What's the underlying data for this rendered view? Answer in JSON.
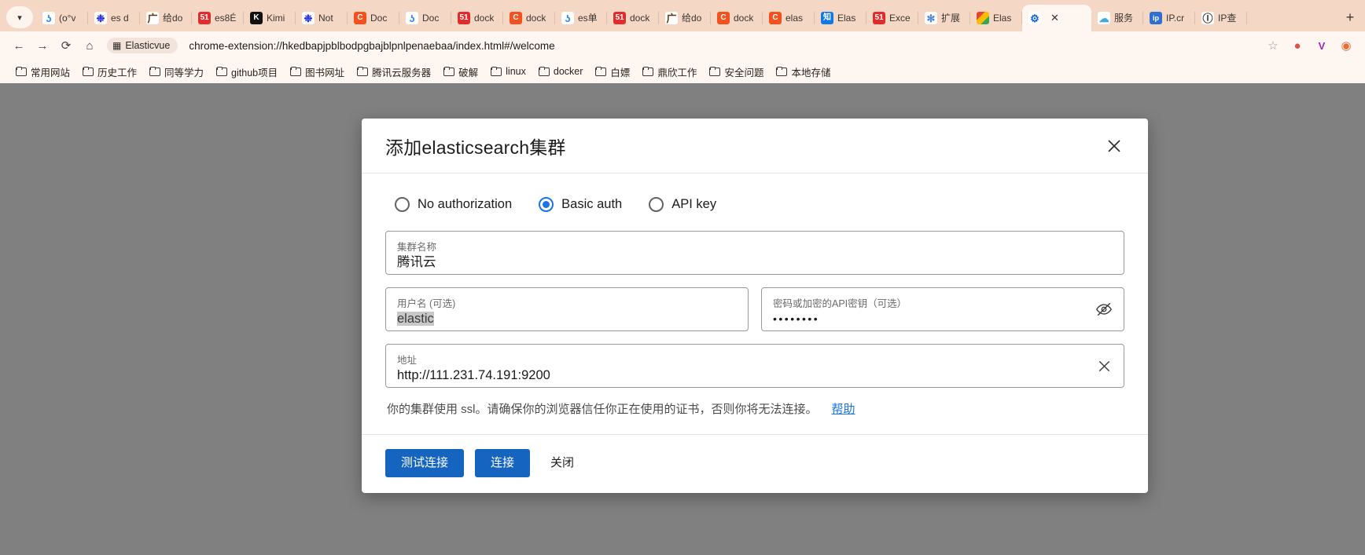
{
  "browser": {
    "tabstrip_toggle_icon": "chevron-down-icon",
    "new_tab_label": "+",
    "tabs": [
      {
        "label": "(o°v",
        "icon": "yuque-icon",
        "active": false
      },
      {
        "label": "es d",
        "icon": "baidu-icon",
        "active": false
      },
      {
        "label": "给do",
        "icon": "juejin-icon",
        "active": false
      },
      {
        "label": "es8É",
        "icon": "51cto-icon",
        "active": false
      },
      {
        "label": "Kimi",
        "icon": "kimi-icon",
        "active": false
      },
      {
        "label": "Not",
        "icon": "baidu-icon",
        "active": false
      },
      {
        "label": "Doc",
        "icon": "csdn-icon",
        "active": false
      },
      {
        "label": "Doc",
        "icon": "yuque-icon",
        "active": false
      },
      {
        "label": "dock",
        "icon": "51cto-icon",
        "active": false
      },
      {
        "label": "dock",
        "icon": "csdn-icon",
        "active": false
      },
      {
        "label": "es单",
        "icon": "yuque-icon",
        "active": false
      },
      {
        "label": "dock",
        "icon": "51cto-icon",
        "active": false
      },
      {
        "label": "给do",
        "icon": "juejin-icon",
        "active": false
      },
      {
        "label": "dock",
        "icon": "csdn-icon",
        "active": false
      },
      {
        "label": "elas",
        "icon": "csdn-icon",
        "active": false
      },
      {
        "label": "Elas",
        "icon": "zhihu-icon",
        "active": false
      },
      {
        "label": "Exce",
        "icon": "51cto-icon",
        "active": false
      },
      {
        "label": "扩展",
        "icon": "puzzle-icon",
        "active": false
      },
      {
        "label": "Elas",
        "icon": "chrome-icon",
        "active": false
      },
      {
        "label": "",
        "icon": "elasticvue-icon",
        "active": true
      },
      {
        "label": "服务",
        "icon": "cloud-icon",
        "active": false
      },
      {
        "label": "IP.cr",
        "icon": "ip-icon",
        "active": false
      },
      {
        "label": "IP查",
        "icon": "ipquery-icon",
        "active": false
      }
    ],
    "toolbar": {
      "back_icon": "back-arrow-icon",
      "forward_icon": "forward-arrow-icon",
      "reload_icon": "reload-icon",
      "home_icon": "home-icon",
      "extension_chip_label": "Elasticvue",
      "extension_chip_icon": "extension-puzzle-icon",
      "url": "chrome-extension://hkedbapjpblbodpgbajblpnlpenaebaa/index.html#/welcome",
      "bookmark_star_icon": "star-icon",
      "extensions_icon": "extensions-icon",
      "vimium_icon": "v-badge-icon",
      "profile_icon": "profile-avatar-icon"
    },
    "bookmarks": [
      {
        "label": "常用网站",
        "icon": "folder-icon"
      },
      {
        "label": "历史工作",
        "icon": "folder-icon"
      },
      {
        "label": "同等学力",
        "icon": "folder-icon"
      },
      {
        "label": "github项目",
        "icon": "folder-icon"
      },
      {
        "label": "图书网址",
        "icon": "folder-icon"
      },
      {
        "label": "腾讯云服务器",
        "icon": "folder-icon"
      },
      {
        "label": "破解",
        "icon": "folder-icon"
      },
      {
        "label": "linux",
        "icon": "folder-icon"
      },
      {
        "label": "docker",
        "icon": "folder-icon"
      },
      {
        "label": "白嫖",
        "icon": "folder-icon"
      },
      {
        "label": "鼎欣工作",
        "icon": "folder-icon"
      },
      {
        "label": "安全问题",
        "icon": "folder-icon"
      },
      {
        "label": "本地存储",
        "icon": "folder-icon"
      }
    ]
  },
  "dialog": {
    "title": "添加elasticsearch集群",
    "close_icon": "close-icon",
    "auth_options": [
      {
        "label": "No authorization",
        "checked": false
      },
      {
        "label": "Basic auth",
        "checked": true
      },
      {
        "label": "API key",
        "checked": false
      }
    ],
    "fields": {
      "cluster_name": {
        "label": "集群名称",
        "value": "腾讯云",
        "placeholder": "集群名称"
      },
      "username": {
        "label": "用户名 (可选)",
        "value": "elastic",
        "placeholder": "用户名 (可选)",
        "selected": true
      },
      "password": {
        "label": "密码或加密的API密钥（可选）",
        "value": "••••••••",
        "placeholder": "密码或加密的API密钥（可选）",
        "trailing_icon": "eye-off-icon"
      },
      "address": {
        "label": "地址",
        "value": "http://111.231.74.191:9200",
        "placeholder": "地址",
        "trailing_icon": "clear-x-icon"
      }
    },
    "ssl_note": "你的集群使用 ssl。请确保你的浏览器信任你正在使用的证书，否则你将无法连接。",
    "help_link": "帮助",
    "buttons": {
      "test": "测试连接",
      "connect": "连接",
      "close": "关闭"
    }
  },
  "colors": {
    "accent": "#1a73e8",
    "button": "#1565c0",
    "chrome_tabstrip": "#f4d7c4",
    "chrome_toolbar": "#fdf6f1",
    "page_backdrop": "#808080"
  }
}
